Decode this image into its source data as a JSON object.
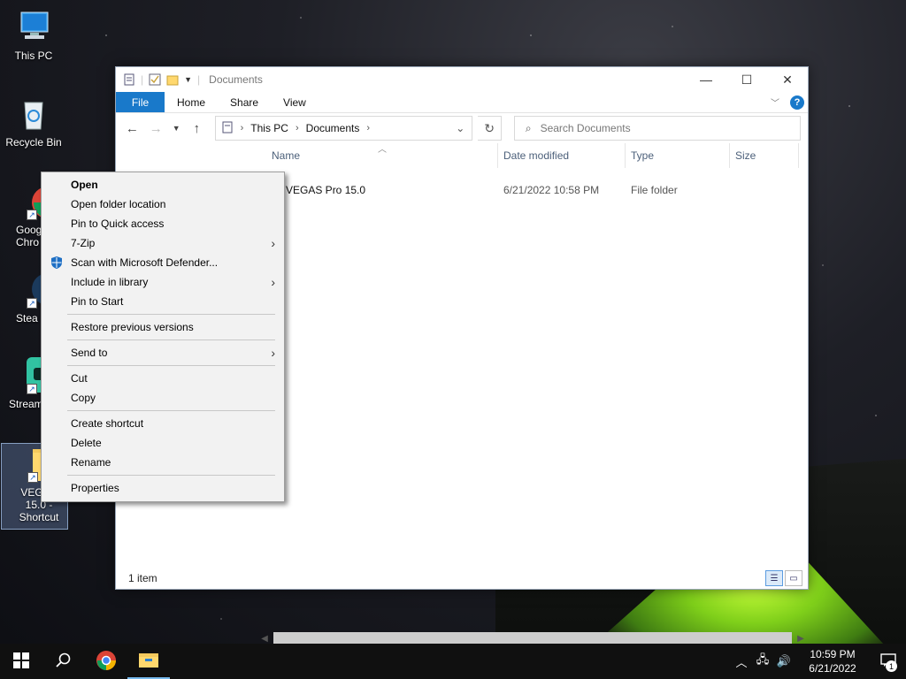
{
  "desktop": {
    "icons": [
      {
        "label": "This PC"
      },
      {
        "label": "Recycle Bin"
      },
      {
        "label": "Google Chrome",
        "visible": "Goog Chro"
      },
      {
        "label": "Steam",
        "visible": "Stea"
      },
      {
        "label": "Streamlabs OBS",
        "visible": "Stream OB"
      },
      {
        "label": "VEGAS 15.0 - Shortcut",
        "visible": "VEGAS 15.0 - Shortcut"
      }
    ]
  },
  "explorer": {
    "title": "Documents",
    "ribbon_tabs": [
      "File",
      "Home",
      "Share",
      "View"
    ],
    "breadcrumb": [
      "This PC",
      "Documents"
    ],
    "search_placeholder": "Search Documents",
    "columns": [
      "Name",
      "Date modified",
      "Type",
      "Size"
    ],
    "rows": [
      {
        "name": "VEGAS Pro 15.0",
        "date": "6/21/2022 10:58 PM",
        "type": "File folder",
        "size": ""
      }
    ],
    "status": "1 item"
  },
  "context_menu": {
    "items": [
      "Open",
      "Open folder location",
      "Pin to Quick access",
      "7-Zip",
      "Scan with Microsoft Defender...",
      "Include in library",
      "Pin to Start",
      "Restore previous versions",
      "Send to",
      "Cut",
      "Copy",
      "Create shortcut",
      "Delete",
      "Rename",
      "Properties"
    ]
  },
  "taskbar": {
    "time": "10:59 PM",
    "date": "6/21/2022",
    "notification_count": "1"
  },
  "colors": {
    "accent": "#1979ca",
    "taskbar": "#101010",
    "menu_bg": "#f2f2f2"
  }
}
